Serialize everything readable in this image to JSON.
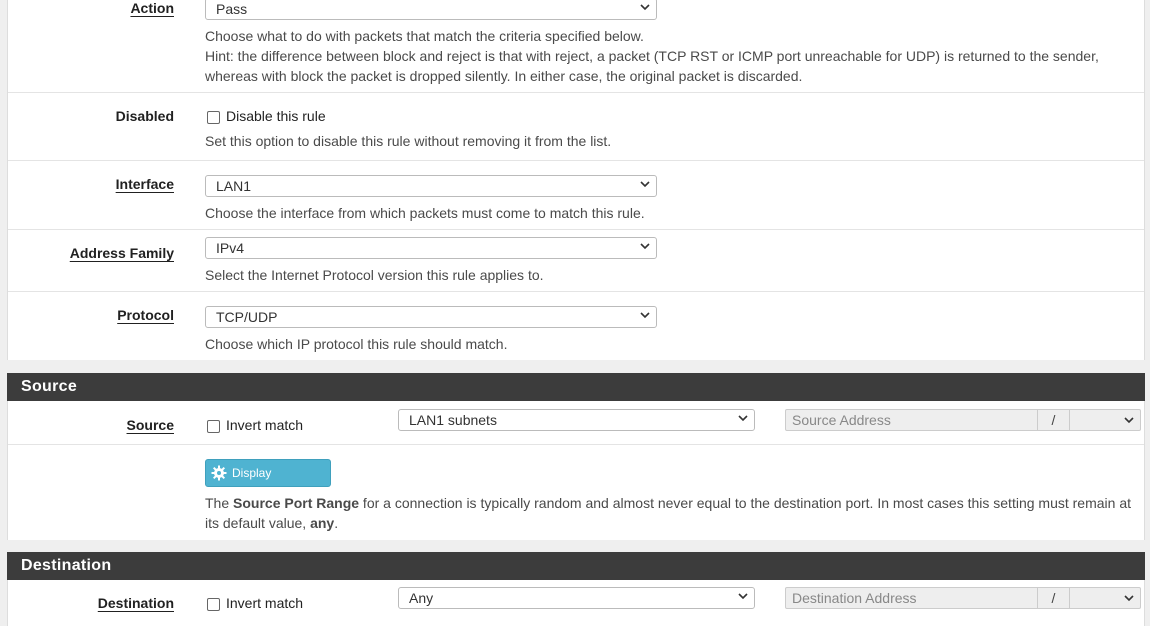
{
  "action": {
    "label": "Action",
    "value": "Pass",
    "help1": "Choose what to do with packets that match the criteria specified below.",
    "help2": "Hint: the difference between block and reject is that with reject, a packet (TCP RST or ICMP port unreachable for UDP) is returned to the sender,",
    "help3": "whereas with block the packet is dropped silently. In either case, the original packet is discarded."
  },
  "disabled": {
    "label": "Disabled",
    "checkbox_label": "Disable this rule",
    "help": "Set this option to disable this rule without removing it from the list."
  },
  "interface": {
    "label": "Interface",
    "value": "LAN1",
    "help": "Choose the interface from which packets must come to match this rule."
  },
  "address_family": {
    "label": "Address Family",
    "value": "IPv4",
    "help": "Select the Internet Protocol version this rule applies to."
  },
  "protocol": {
    "label": "Protocol",
    "value": "TCP/UDP",
    "help": "Choose which IP protocol this rule should match."
  },
  "source_section": {
    "header": "Source",
    "label": "Source",
    "invert_label": "Invert match",
    "type_value": "LAN1 subnets",
    "address_placeholder": "Source Address",
    "slash": "/",
    "advanced_button": "Display Advanced",
    "help_pre": "The ",
    "help_bold": "Source Port Range",
    "help_mid": " for a connection is typically random and almost never equal to the destination port. In most cases this setting must remain at",
    "help_line2_pre": "its default value, ",
    "help_line2_bold": "any",
    "help_line2_post": "."
  },
  "destination_section": {
    "header": "Destination",
    "label": "Destination",
    "invert_label": "Invert match",
    "type_value": "Any",
    "address_placeholder": "Destination Address",
    "slash": "/"
  },
  "colors": {
    "section_header_bg": "#3c3c3c",
    "button_bg": "#4fb3d1",
    "page_bg": "#efefef"
  }
}
